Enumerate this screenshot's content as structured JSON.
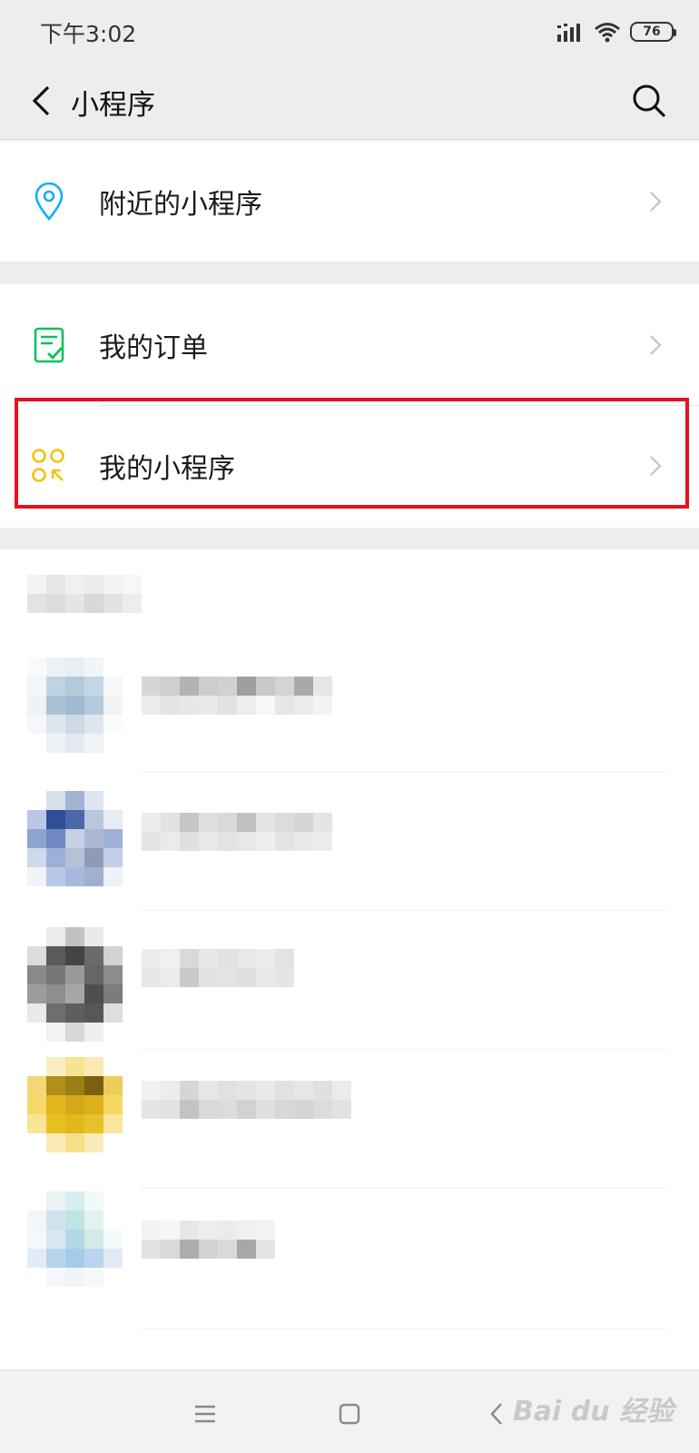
{
  "status_bar": {
    "time": "下午3:02",
    "battery": "76",
    "icons": [
      "signal-icon",
      "wifi-icon",
      "battery-icon"
    ]
  },
  "nav": {
    "title": "小程序",
    "back_icon": "chevron-left-icon",
    "search_icon": "search-icon"
  },
  "menu": {
    "nearby": {
      "label": "附近的小程序",
      "icon": "location-pin-icon",
      "color": "#10aeff"
    },
    "orders": {
      "label": "我的订单",
      "icon": "order-check-icon",
      "color": "#07c160"
    },
    "my_mini_programs": {
      "label": "我的小程序",
      "icon": "mini-program-icon",
      "color": "#f1c40f"
    }
  },
  "annotation": {
    "highlight_color": "#e8101e"
  },
  "bottom_nav": {
    "icons": [
      "menu-icon",
      "home-square-icon",
      "back-triangle-icon"
    ],
    "watermark": "Bai du 经验"
  }
}
